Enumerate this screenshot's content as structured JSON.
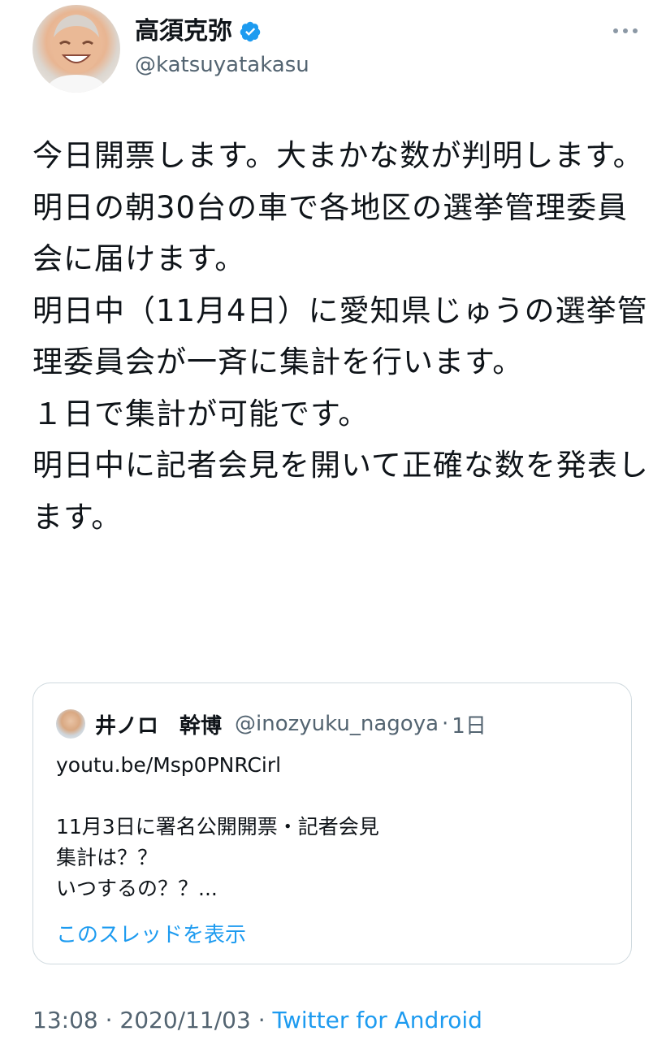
{
  "author": {
    "display_name": "高須克弥",
    "handle": "@katsuyatakasu",
    "verified": true
  },
  "tweet": {
    "text": "今日開票します。大まかな数が判明します。\n明日の朝30台の車で各地区の選挙管理委員会に届けます。\n明日中（11月4日）に愛知県じゅうの選挙管理委員会が一斉に集計を行います。\n１日で集計が可能です。\n明日中に記者会見を開いて正確な数を発表します。"
  },
  "quoted_tweet": {
    "display_name": "井ノロ　幹博",
    "handle": "@inozyuku_nagoya",
    "separator": "·",
    "time": "1日",
    "text": "youtu.be/Msp0PNRCirl\n\n11月3日に署名公開開票・記者会見\n集計は？？\nいつするの？？...",
    "show_thread_label": "このスレッドを表示"
  },
  "meta": {
    "time": "13:08",
    "separator1": " · ",
    "date": "2020/11/03",
    "separator2": " · ",
    "source": "Twitter for Android"
  },
  "colors": {
    "link": "#1d9bf0",
    "secondary_text": "#536471",
    "border": "#cfd9de",
    "verified_badge": "#1d9bf0"
  },
  "icons": {
    "verified": "verified-badge-icon",
    "more": "more-options-icon"
  }
}
